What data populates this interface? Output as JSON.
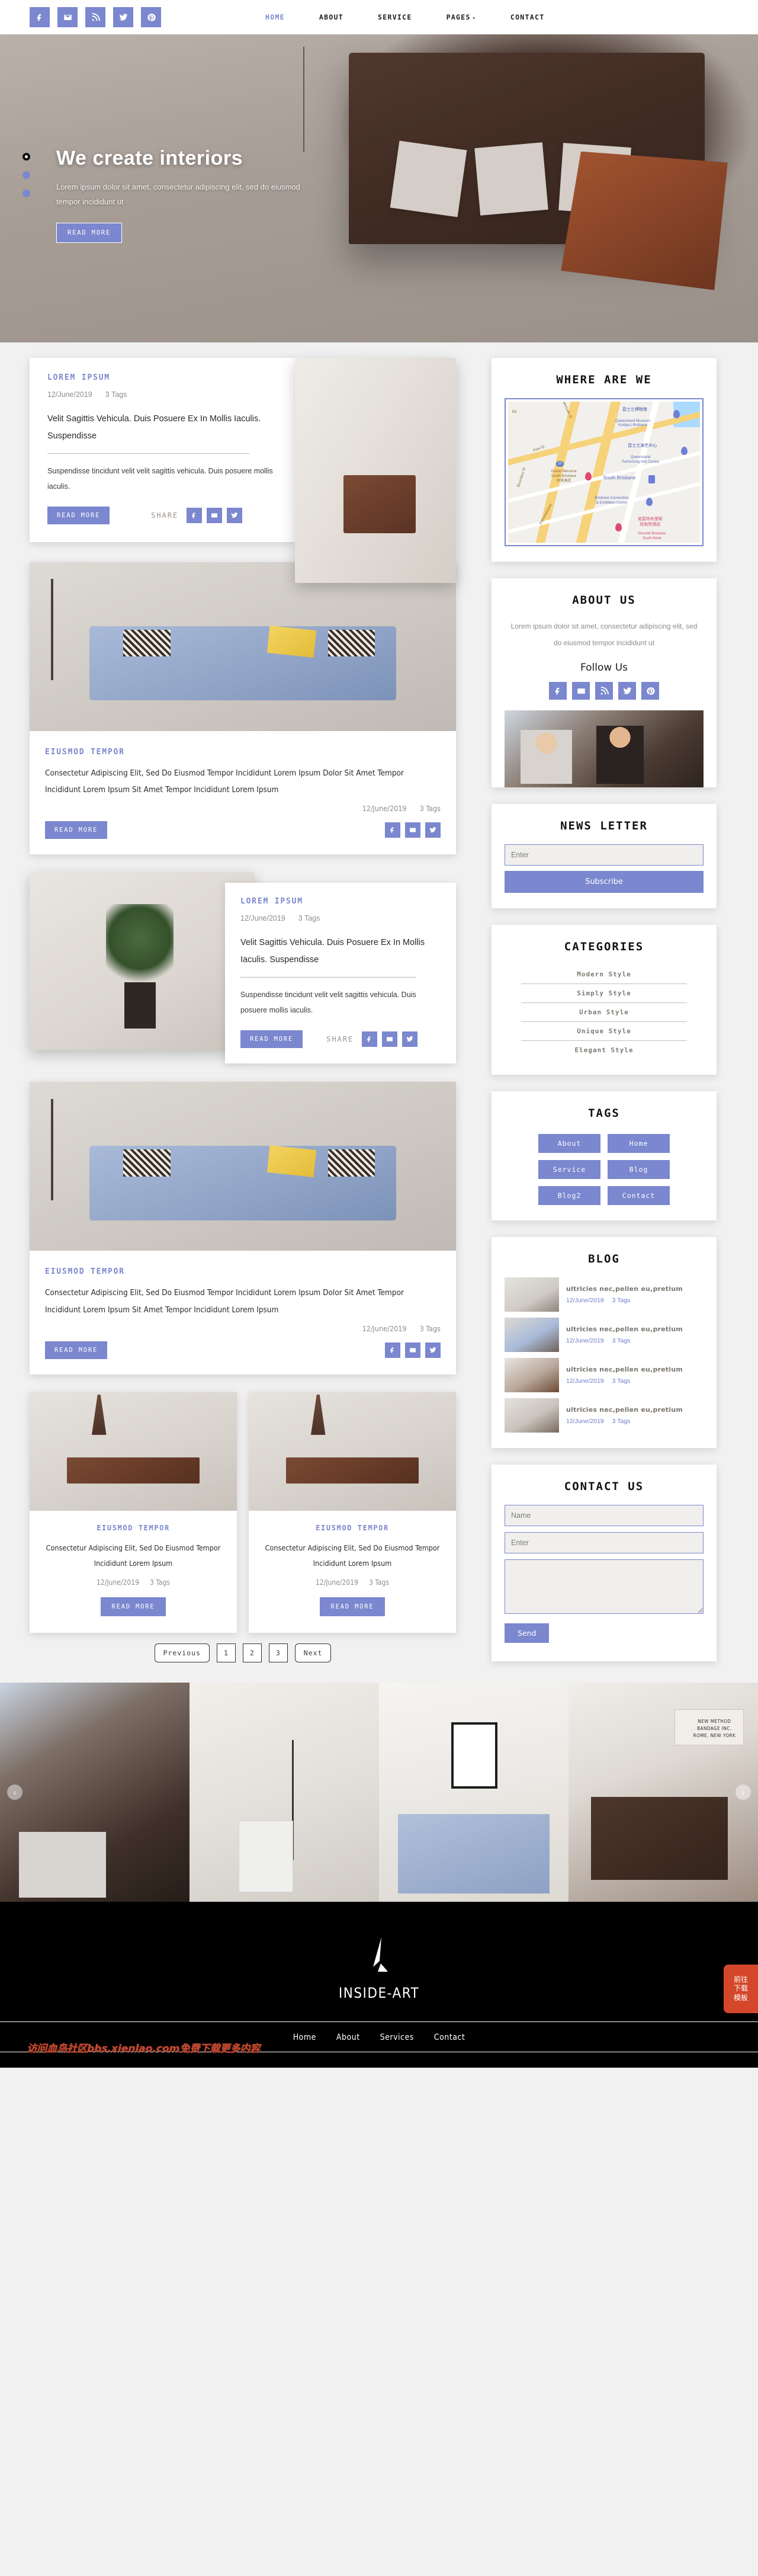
{
  "topbar": {
    "social": [
      "facebook-icon",
      "envelope-icon",
      "rss-icon",
      "twitter-icon",
      "pinterest-icon"
    ],
    "nav": [
      {
        "label": "HOME",
        "active": true
      },
      {
        "label": "ABOUT",
        "active": false
      },
      {
        "label": "SERVICE",
        "active": false
      },
      {
        "label": "PAGES",
        "active": false,
        "caret": "▾"
      },
      {
        "label": "CONTACT",
        "active": false
      }
    ]
  },
  "hero": {
    "title": "We create interiors",
    "subtitle": "Lorem ipsum dolor sit amet, consectetur adipiscing elit, sed do eiusmod tempor incididunt ut",
    "button": "READ MORE",
    "dots": 3
  },
  "posts": {
    "post1": {
      "category": "LOREM IPSUM",
      "date": "12/June/2019",
      "tags": "3 Tags",
      "heading": "Velit Sagittis Vehicula. Duis Posuere Ex In Mollis Iaculis. Suspendisse",
      "body": "Suspendisse tincidunt velit velit sagittis vehicula. Duis posuere mollis iaculis.",
      "read_more": "READ MORE",
      "share_label": "SHARE"
    },
    "post2": {
      "category": "EIUSMOD TEMPOR",
      "text": "Consectetur Adipiscing Elit, Sed Do Eiusmod Tempor Incididunt Lorem Ipsum Dolor Sit Amet Tempor Incididunt Lorem Ipsum Sit Amet Tempor Incididunt Lorem Ipsum",
      "date": "12/June/2019",
      "tags": "3 Tags",
      "read_more": "READ MORE"
    },
    "post3": {
      "category": "LOREM IPSUM",
      "date": "12/June/2019",
      "tags": "3 Tags",
      "heading": "Velit Sagittis Vehicula. Duis Posuere Ex In Mollis Iaculis. Suspendisse",
      "body": "Suspendisse tincidunt velit velit sagittis vehicula. Duis posuere mollis iaculis.",
      "read_more": "READ MORE",
      "share_label": "SHARE"
    },
    "post4": {
      "category": "EIUSMOD TEMPOR",
      "text": "Consectetur Adipiscing Elit, Sed Do Eiusmod Tempor Incididunt Lorem Ipsum Dolor Sit Amet Tempor Incididunt Lorem Ipsum Sit Amet Tempor Incididunt Lorem Ipsum",
      "date": "12/June/2019",
      "tags": "3 Tags",
      "read_more": "READ MORE"
    },
    "mini1": {
      "category": "EIUSMOD TEMPOR",
      "text": "Consectetur Adipiscing Elit, Sed Do Eiusmod Tempor Incididunt Lorem Ipsum",
      "date": "12/June/2019",
      "tags": "3 Tags",
      "read_more": "READ MORE"
    },
    "mini2": {
      "category": "EIUSMOD TEMPOR",
      "text": "Consectetur Adipiscing Elit, Sed Do Eiusmod Tempor Incididunt Lorem Ipsum",
      "date": "12/June/2019",
      "tags": "3 Tags",
      "read_more": "READ MORE"
    }
  },
  "pager": {
    "previous": "Previous",
    "pages": [
      "1",
      "2",
      "3"
    ],
    "next": "Next"
  },
  "sidebar": {
    "where": {
      "title": "WHERE ARE WE",
      "map_labels": {
        "museum_cn": "昆士兰博物馆",
        "museum_en": "Queensland Museum\nKurilpa | Brisbane",
        "pac_cn": "昆士兰演艺中心",
        "pac_en": "Queensland\nPerforming Arts Centre",
        "gelato": "Gelato Messina\nSouth Brisbane\n冰淇淋店",
        "south_brisbane": "South Brisbane",
        "convention": "Brisbane Convention\n& Exhibition Centre",
        "novotel_cn": "诺富特布里斯\n班南岸酒店",
        "novotel_en": "Novotel Brisbane\nSouth Bank",
        "st_peel": "Peel St",
        "st_boundary": "Boundary St",
        "st_merivale": "Merivale St",
        "st_edmondstone": "Edmondstone",
        "st_rd": "Rd",
        "highway": "10"
      }
    },
    "about": {
      "title": "ABOUT US",
      "text": "Lorem ipsum dolor sit amet, consectetur adipiscing elit, sed do eiusmod tempor incididunt ut",
      "follow_title": "Follow Us",
      "social": [
        "facebook-icon",
        "envelope-icon",
        "rss-icon",
        "twitter-icon",
        "pinterest-icon"
      ]
    },
    "newsletter": {
      "title": "NEWS LETTER",
      "placeholder": "Enter",
      "button": "Subscribe"
    },
    "categories": {
      "title": "CATEGORIES",
      "items": [
        "Modern Style",
        "Simply Style",
        "Urban Style",
        "Unique Style",
        "Elegant Style"
      ]
    },
    "tags": {
      "title": "TAGS",
      "items": [
        "About",
        "Home",
        "Service",
        "Blog",
        "Blog2",
        "Contact"
      ]
    },
    "blog": {
      "title": "BLOG",
      "items": [
        {
          "title": "ultricies nec,pellen eu,pretium",
          "date": "12/June/2019",
          "tags": "3 Tags"
        },
        {
          "title": "ultricies nec,pellen eu,pretium",
          "date": "12/June/2019",
          "tags": "3 Tags"
        },
        {
          "title": "ultricies nec,pellen eu,pretium",
          "date": "12/June/2019",
          "tags": "3 Tags"
        },
        {
          "title": "ultricies nec,pellen eu,pretium",
          "date": "12/June/2019",
          "tags": "3 Tags"
        }
      ]
    },
    "contact": {
      "title": "CONTACT US",
      "name_placeholder": "Name",
      "email_placeholder": "Enter",
      "message_placeholder": "",
      "button": "Send"
    }
  },
  "carousel": {
    "prev": "‹",
    "next": "›",
    "slide4_sign": "NEW METHOD\nBANDAGE INC.\nROME, NEW YORK"
  },
  "footer": {
    "brand": "INSIDE-ART",
    "nav": [
      "Home",
      "About",
      "Services",
      "Contact"
    ],
    "watermark": "访问血鸟社区bbs.xienlao.com免费下载更多内容",
    "download_badge": "前往下载模板"
  },
  "colors": {
    "accent": "#7b87ce",
    "footer_bg": "#000000",
    "badge": "#d4472a"
  }
}
